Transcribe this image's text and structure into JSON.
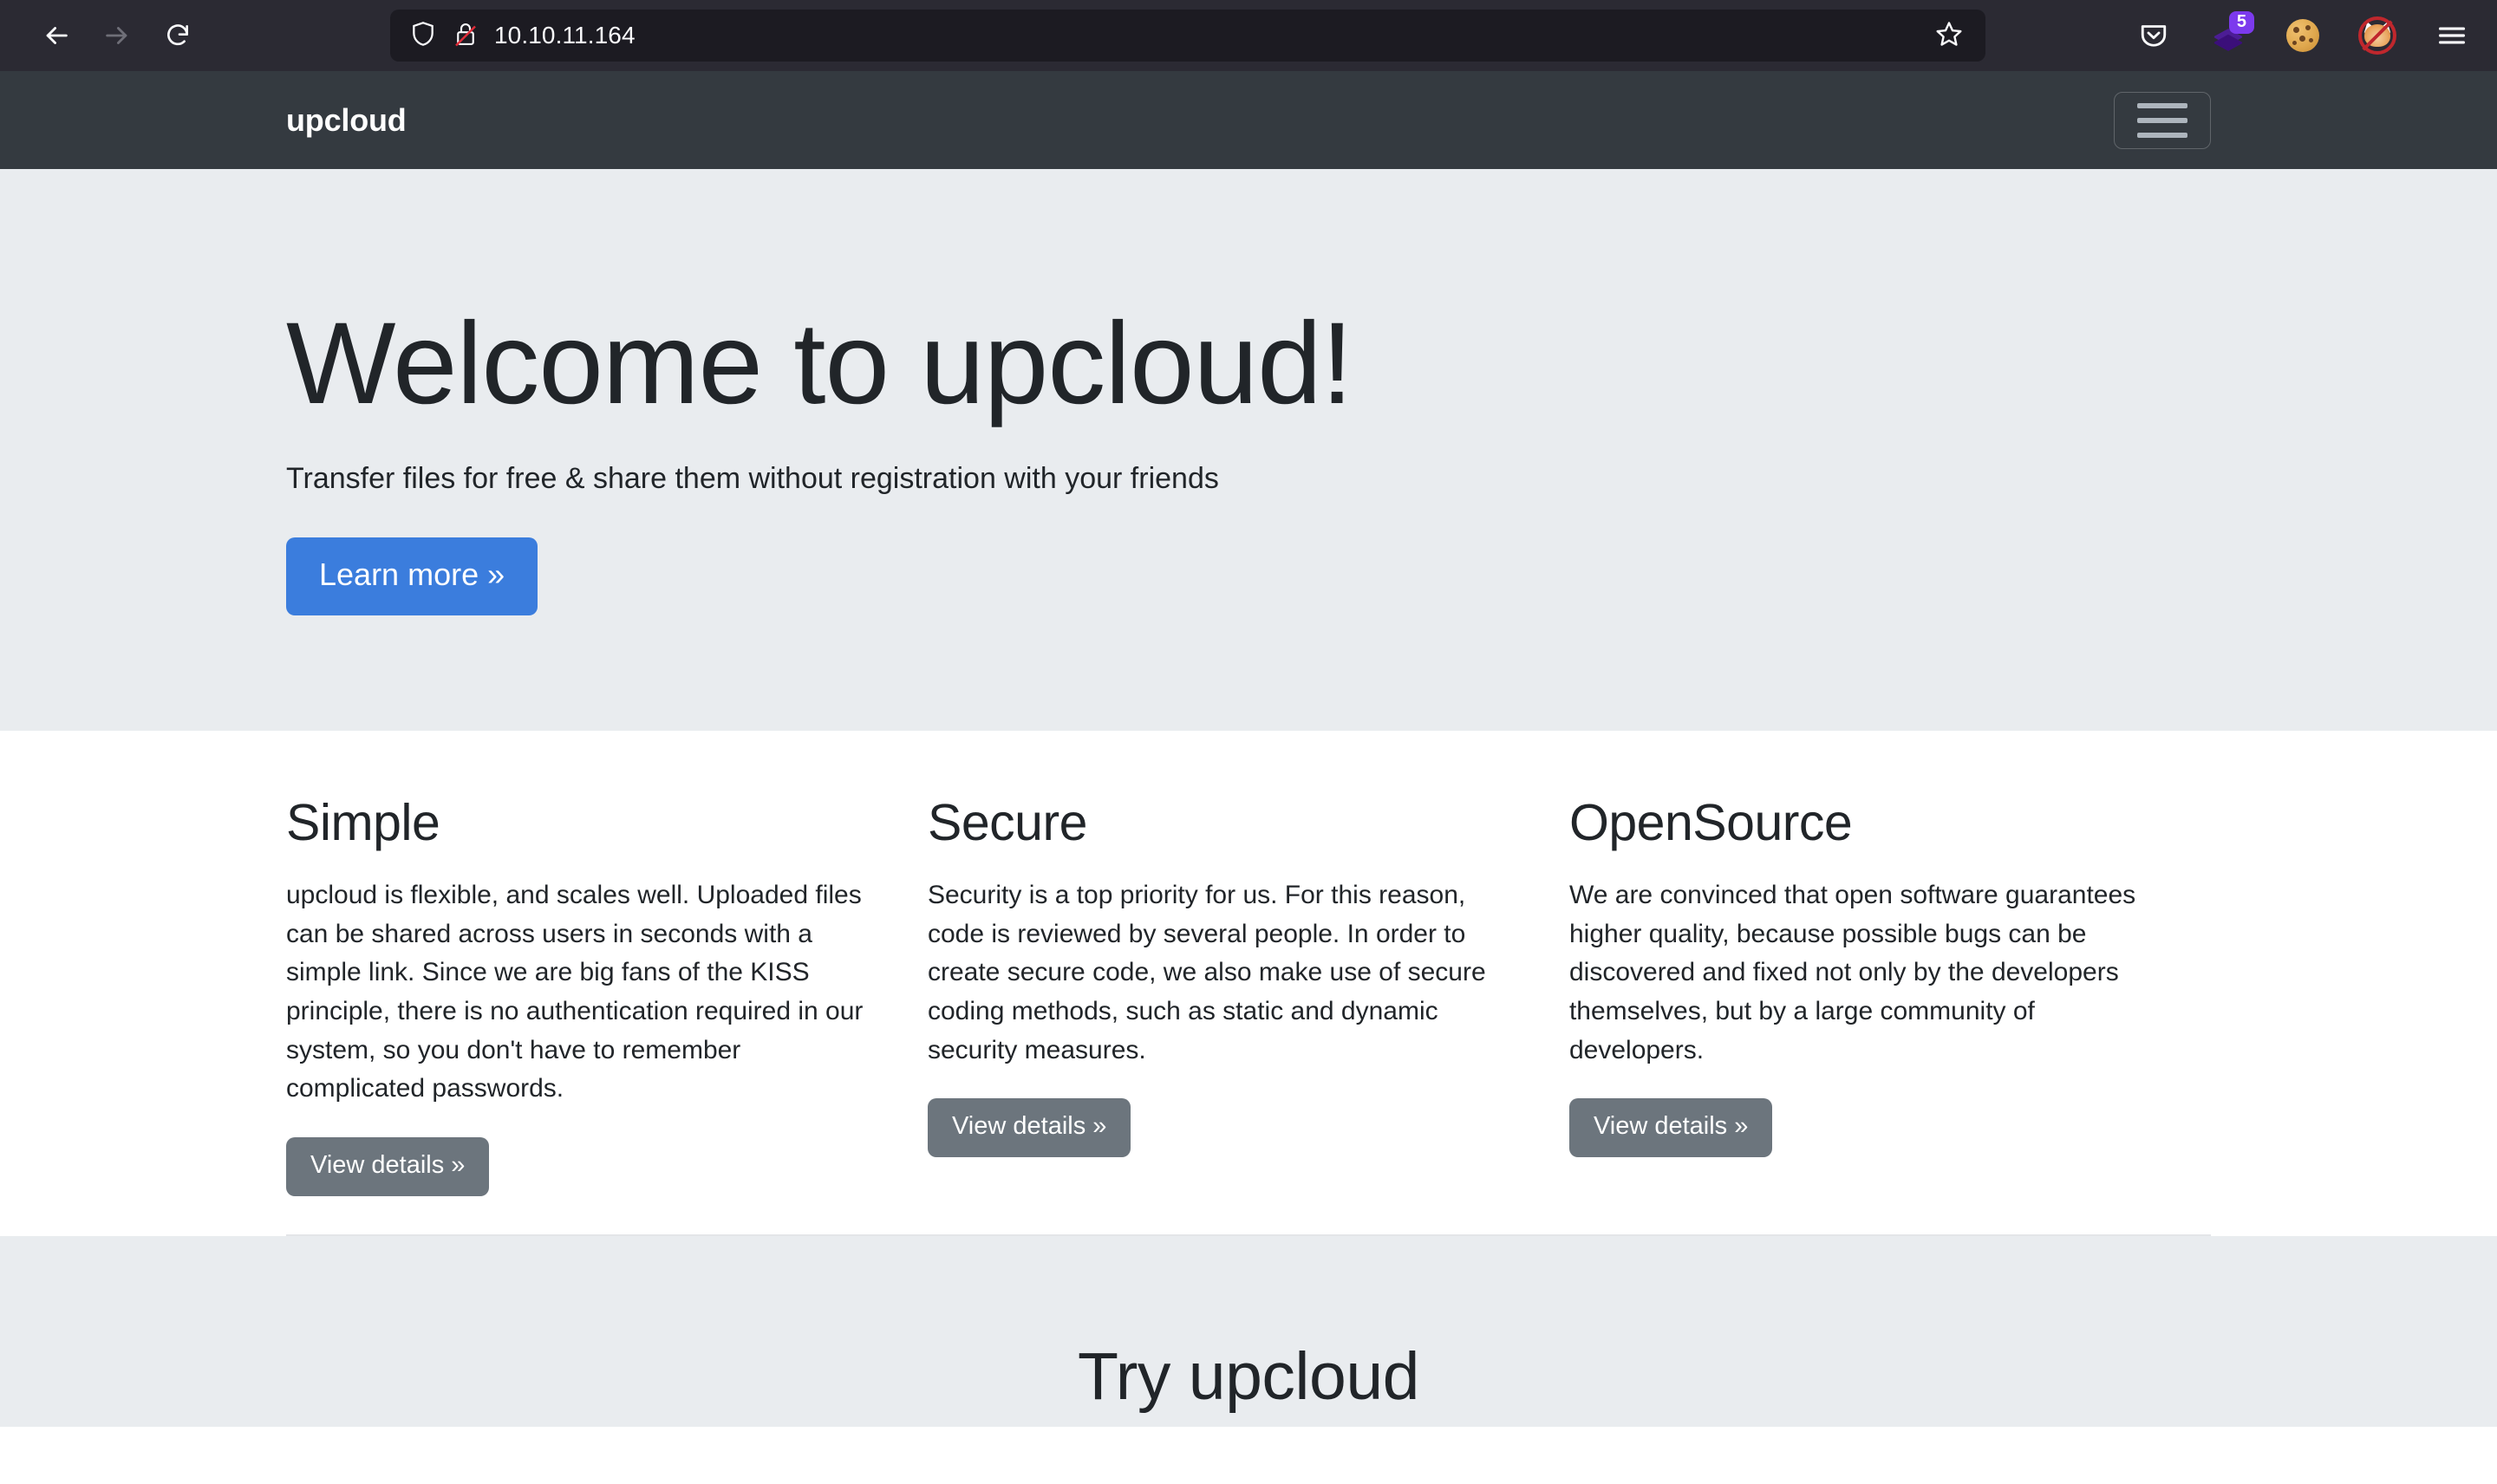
{
  "browser": {
    "back_icon": "back-arrow-icon",
    "forward_icon": "forward-arrow-icon",
    "reload_icon": "reload-icon",
    "shield_icon": "shield-icon",
    "lock_icon": "broken-lock-icon",
    "url": "10.10.11.164",
    "bookmark_icon": "star-icon",
    "toolbar_icons": [
      {
        "name": "pocket-icon",
        "label": "Pocket"
      },
      {
        "name": "layers-extension-icon",
        "label": "Layers",
        "badge": "5"
      },
      {
        "name": "cookie-icon",
        "label": "Cookie"
      },
      {
        "name": "fox-blocked-icon",
        "label": "Fox blocked"
      },
      {
        "name": "hamburger-menu-icon",
        "label": "Open application menu"
      }
    ]
  },
  "site": {
    "brand": "upcloud",
    "toggler_label": "Toggle navigation"
  },
  "hero": {
    "title": "Welcome to upcloud!",
    "lead": "Transfer files for free & share them without registration with your friends",
    "cta": "Learn more »"
  },
  "features": [
    {
      "heading": "Simple",
      "body": "upcloud is flexible, and scales well. Uploaded files can be shared across users in seconds with a simple link. Since we are big fans of the KISS principle, there is no authentication required in our system, so you don't have to remember complicated passwords.",
      "button": "View details »"
    },
    {
      "heading": "Secure",
      "body": "Security is a top priority for us. For this reason, code is reviewed by several people. In order to create secure code, we also make use of secure coding methods, such as static and dynamic security measures.",
      "button": "View details »"
    },
    {
      "heading": "OpenSource",
      "body": "We are convinced that open software guarantees higher quality, because possible bugs can be discovered and fixed not only by the developers themselves, but by a large community of developers.",
      "button": "View details »"
    }
  ],
  "try_section": {
    "title": "Try upcloud"
  },
  "colors": {
    "navbar_dark": "#343a40",
    "jumbotron_bg": "#e9ecef",
    "primary_button": "#3b7ddd",
    "secondary_button": "#6c757d",
    "browser_chrome": "#2b2a33",
    "urlbar_bg": "#1c1b22",
    "badge_purple": "#7c3aed"
  }
}
